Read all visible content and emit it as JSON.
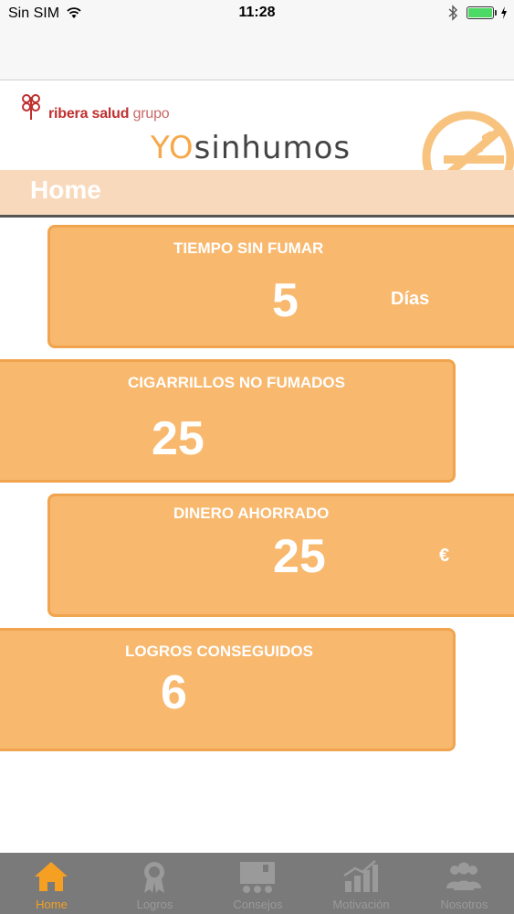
{
  "status_bar": {
    "carrier": "Sin SIM",
    "time": "11:28"
  },
  "header": {
    "brand_bold": "ribera salud",
    "brand_light": "grupo",
    "app_title_yo": "YO",
    "app_title_rest": "sinhumos",
    "page_title": "Home"
  },
  "cards": {
    "tiempo": {
      "title": "TIEMPO SIN FUMAR",
      "value": "5",
      "unit": "Días"
    },
    "cigarrillos": {
      "title": "CIGARRILLOS NO FUMADOS",
      "value": "25"
    },
    "dinero": {
      "title": "DINERO AHORRADO",
      "value": "25",
      "unit": "€"
    },
    "logros": {
      "title": "LOGROS CONSEGUIDOS",
      "value": "6"
    }
  },
  "tabs": [
    {
      "label": "Home",
      "icon": "home-icon",
      "active": true
    },
    {
      "label": "Logros",
      "icon": "medal-icon",
      "active": false
    },
    {
      "label": "Consejos",
      "icon": "presentation-icon",
      "active": false
    },
    {
      "label": "Motivación",
      "icon": "growth-chart-icon",
      "active": false
    },
    {
      "label": "Nosotros",
      "icon": "group-icon",
      "active": false
    }
  ],
  "colors": {
    "accent": "#f5a023",
    "card_fill": "#f8b86e",
    "card_border": "#f0a44e",
    "home_band": "#f9d9bb",
    "tabbar": "#7a7a7a"
  }
}
